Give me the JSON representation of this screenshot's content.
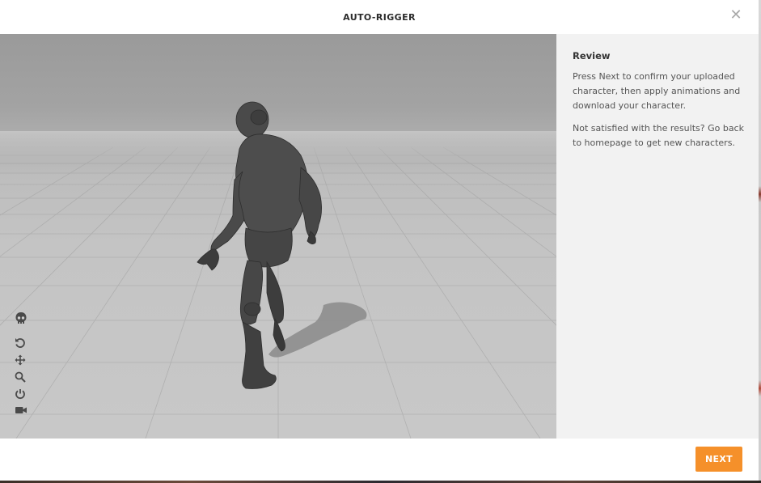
{
  "modal": {
    "title": "AUTO-RIGGER",
    "close_icon": "close-icon"
  },
  "viewport": {
    "description_icon": "3d-viewport",
    "tools": [
      {
        "icon": "skeleton-icon"
      },
      {
        "icon": "reset-rotation-icon"
      },
      {
        "icon": "pan-icon"
      },
      {
        "icon": "zoom-icon"
      },
      {
        "icon": "power-icon"
      },
      {
        "icon": "camera-icon"
      }
    ]
  },
  "sidebar": {
    "heading": "Review",
    "paragraph1": "Press Next to confirm your uploaded character, then apply animations and download your character.",
    "paragraph2": "Not satisfied with the results? Go back to homepage to get new characters."
  },
  "footer": {
    "next_label": "NEXT"
  },
  "colors": {
    "accent": "#f5902a",
    "sidebar_bg": "#f2f2f2",
    "tool_icon": "#4a4a4a"
  }
}
